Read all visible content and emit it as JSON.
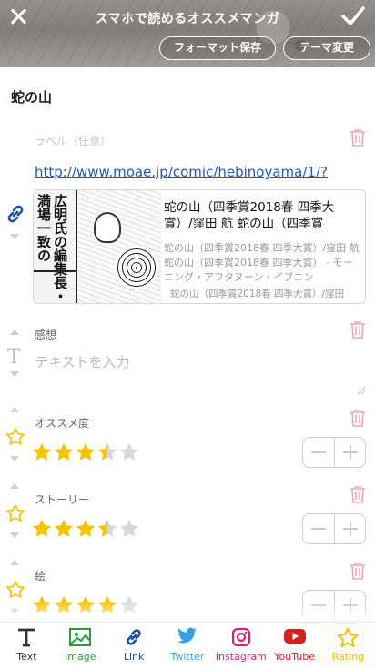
{
  "header": {
    "title": "スマホで読めるオススメマンガ",
    "format_save": "フォーマット保存",
    "theme_change": "テーマ変更"
  },
  "page_title": "蛇の山",
  "link_block": {
    "label_placeholder": "ラベル（任意）",
    "url": "http://www.moae.jp/comic/hebinoyama/1/?",
    "card": {
      "thumb_text": "広明氏の編集長・満場一致の",
      "title": "蛇の山（四季賞2018春 四季大賞）/窪田 航 蛇の山（四季賞",
      "description": "蛇の山（四季賞2018春 四季大賞）/窪田 航 蛇の山（四季賞2018春 四季大賞） - モーニング・アフタヌーン・イブニン",
      "site": "蛇の山（四季賞2018春 四季大賞）/窪田"
    }
  },
  "text_block": {
    "label": "感想",
    "placeholder": "テキストを入力"
  },
  "ratings": [
    {
      "label": "オススメ度",
      "value": 3.5,
      "max": 5
    },
    {
      "label": "ストーリー",
      "value": 3.5,
      "max": 5
    },
    {
      "label": "絵",
      "value": 4,
      "max": 5
    }
  ],
  "toolbar": [
    {
      "label": "Text",
      "icon": "text-icon",
      "color": "#333333"
    },
    {
      "label": "Image",
      "icon": "image-icon",
      "color": "#2a9d3a"
    },
    {
      "label": "Link",
      "icon": "link-icon",
      "color": "#1a4fa8"
    },
    {
      "label": "Twitter",
      "icon": "twitter-icon",
      "color": "#3aa0e6"
    },
    {
      "label": "Instagram",
      "icon": "instagram-icon",
      "color": "#d6246e"
    },
    {
      "label": "YouTube",
      "icon": "youtube-icon",
      "color": "#d62020"
    },
    {
      "label": "Rating",
      "icon": "star-icon",
      "color": "#f2c200"
    }
  ],
  "colors": {
    "accent_pink": "#f2a7b4",
    "star_yellow": "#f5c400",
    "star_empty": "#d8d8d8",
    "link_blue": "#1a58c8"
  }
}
